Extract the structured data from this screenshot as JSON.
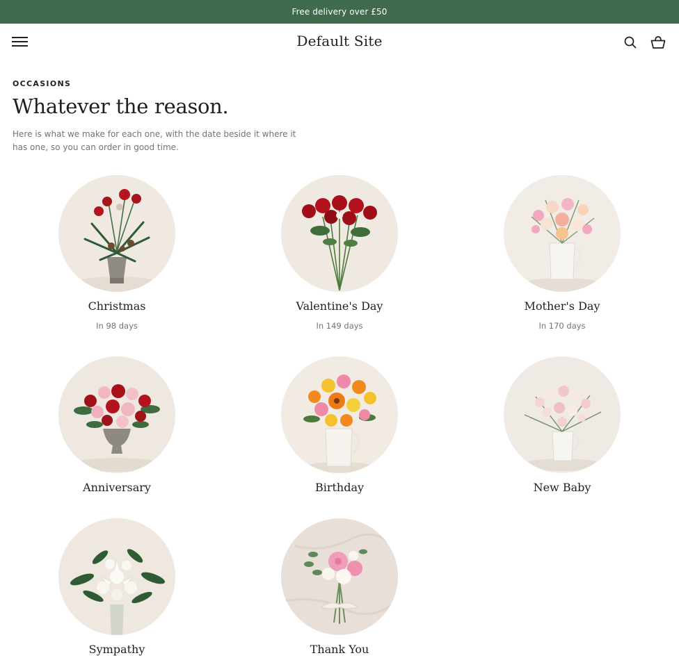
{
  "announcement": {
    "text": "Free delivery over £50"
  },
  "header": {
    "title": "Default Site",
    "menu_icon": "hamburger-menu-icon",
    "search_icon": "search-icon",
    "cart_icon": "shopping-basket-icon"
  },
  "section": {
    "eyebrow": "OCCASIONS",
    "heading": "Whatever the reason.",
    "intro": "Here is what we make for each one, with the date beside it where it has one, so you can order in good time."
  },
  "occasions": [
    {
      "name": "Christmas",
      "days": "In 98 days"
    },
    {
      "name": "Valentine's Day",
      "days": "In 149 days"
    },
    {
      "name": "Mother's Day",
      "days": "In 170 days"
    },
    {
      "name": "Anniversary",
      "days": ""
    },
    {
      "name": "Birthday",
      "days": ""
    },
    {
      "name": "New Baby",
      "days": ""
    },
    {
      "name": "Sympathy",
      "days": ""
    },
    {
      "name": "Thank You",
      "days": ""
    }
  ],
  "colors": {
    "announcement_bg": "#3f6b4c",
    "text": "#1f1f1f",
    "muted": "#737373",
    "photo_bg": "#efe9e2"
  }
}
